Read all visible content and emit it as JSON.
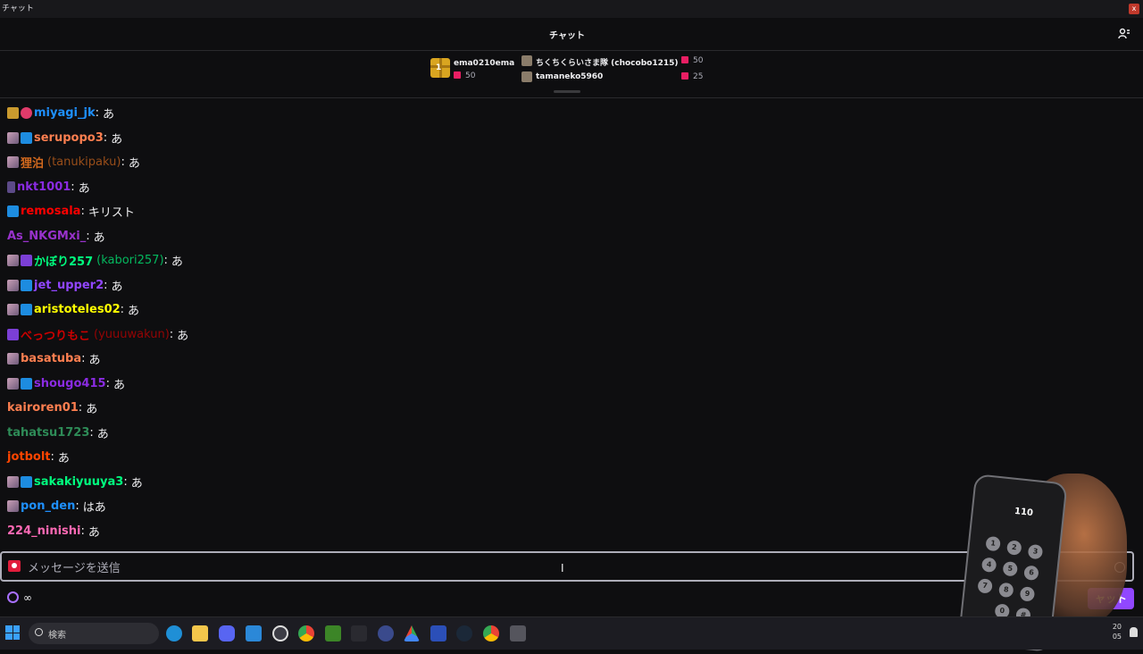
{
  "window": {
    "title": "チャット",
    "close": "x"
  },
  "header": {
    "title": "チャット"
  },
  "leaderboard": {
    "rank1": {
      "rank": "1",
      "name": "ema0210ema",
      "count": "50"
    },
    "rank2": {
      "name": "ちくちくらいさま隊 (chocobo1215)",
      "count": "50"
    },
    "rank3": {
      "name": "tamaneko5960",
      "count": "25"
    }
  },
  "messages": [
    {
      "name": "miyagi_jk",
      "login": "",
      "text": "あ",
      "color": "#1e90ff"
    },
    {
      "name": "serupopo3",
      "login": "",
      "text": "あ",
      "color": "#ff7f50"
    },
    {
      "name": "狸泊",
      "login": "(tanukipaku)",
      "text": "あ",
      "color": "#d2691e"
    },
    {
      "name": "nkt1001",
      "login": "",
      "text": "あ",
      "color": "#8a2be2"
    },
    {
      "name": "remosala",
      "login": "",
      "text": "キリスト",
      "color": "#ff0000"
    },
    {
      "name": "As_NKGMxi_",
      "login": "",
      "text": "あ",
      "color": "#9932cc"
    },
    {
      "name": "かぼり257",
      "login": "(kabori257)",
      "text": "あ",
      "color": "#00ff7f"
    },
    {
      "name": "jet_upper2",
      "login": "",
      "text": "あ",
      "color": "#9146ff"
    },
    {
      "name": "aristoteles02",
      "login": "",
      "text": "あ",
      "color": "#ffff00"
    },
    {
      "name": "べっつりもこ",
      "login": "(yuuuwakun)",
      "text": "あ",
      "color": "#cc0000"
    },
    {
      "name": "basatuba",
      "login": "",
      "text": "あ",
      "color": "#ff7f50"
    },
    {
      "name": "shougo415",
      "login": "",
      "text": "あ",
      "color": "#8a2be2"
    },
    {
      "name": "kairoren01",
      "login": "",
      "text": "あ",
      "color": "#ff7f50"
    },
    {
      "name": "tahatsu1723",
      "login": "",
      "text": "あ",
      "color": "#2e8b57"
    },
    {
      "name": "jotbolt",
      "login": "",
      "text": "あ",
      "color": "#ff4500"
    },
    {
      "name": "sakakiyuuya3",
      "login": "",
      "text": "あ",
      "color": "#00ff7f"
    },
    {
      "name": "pon_den",
      "login": "",
      "text": "はあ",
      "color": "#1e90ff"
    },
    {
      "name": "224_ninishi",
      "login": "",
      "text": "あ",
      "color": "#ff69b4"
    }
  ],
  "input": {
    "placeholder": "メッセージを送信"
  },
  "points": {
    "value": "∞"
  },
  "chat_button": "ャット",
  "taskbar": {
    "search_label": "検索",
    "clock_line1": "20",
    "clock_line2": "05"
  },
  "phone": {
    "number": "110",
    "keys": [
      "1",
      "2",
      "3",
      "4",
      "5",
      "6",
      "7",
      "8",
      "9",
      "0",
      "#"
    ]
  }
}
